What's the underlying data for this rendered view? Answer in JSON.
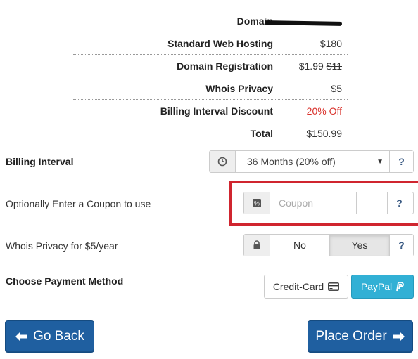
{
  "summary": {
    "domain_label": "Domain",
    "hosting_label": "Standard Web Hosting",
    "hosting_value": "$180",
    "registration_label": "Domain Registration",
    "registration_value": "$1.99",
    "registration_old": "$11",
    "privacy_label": "Whois Privacy",
    "privacy_value": "$5",
    "discount_label": "Billing Interval Discount",
    "discount_value": "20% Off",
    "total_label": "Total",
    "total_value": "$150.99"
  },
  "billing": {
    "label": "Billing Interval",
    "selected": "36 Months (20% off)",
    "icon": "clock-icon",
    "help": "?"
  },
  "coupon": {
    "label": "Optionally Enter a Coupon to use",
    "placeholder": "Coupon",
    "value": "",
    "icon": "percent-tag-icon",
    "help": "?"
  },
  "whois": {
    "label": "Whois Privacy for $5/year",
    "icon": "lock-icon",
    "options": [
      "No",
      "Yes"
    ],
    "selected": "Yes",
    "help": "?"
  },
  "payment": {
    "label": "Choose Payment Method",
    "credit_card": "Credit-Card",
    "paypal": "PayPal"
  },
  "actions": {
    "back": "Go Back",
    "place_order": "Place Order"
  },
  "colors": {
    "accent_blue": "#1f5fa0",
    "paypal_blue": "#31b0d5",
    "discount_red": "#d9312b",
    "highlight_red": "#d0252f"
  }
}
